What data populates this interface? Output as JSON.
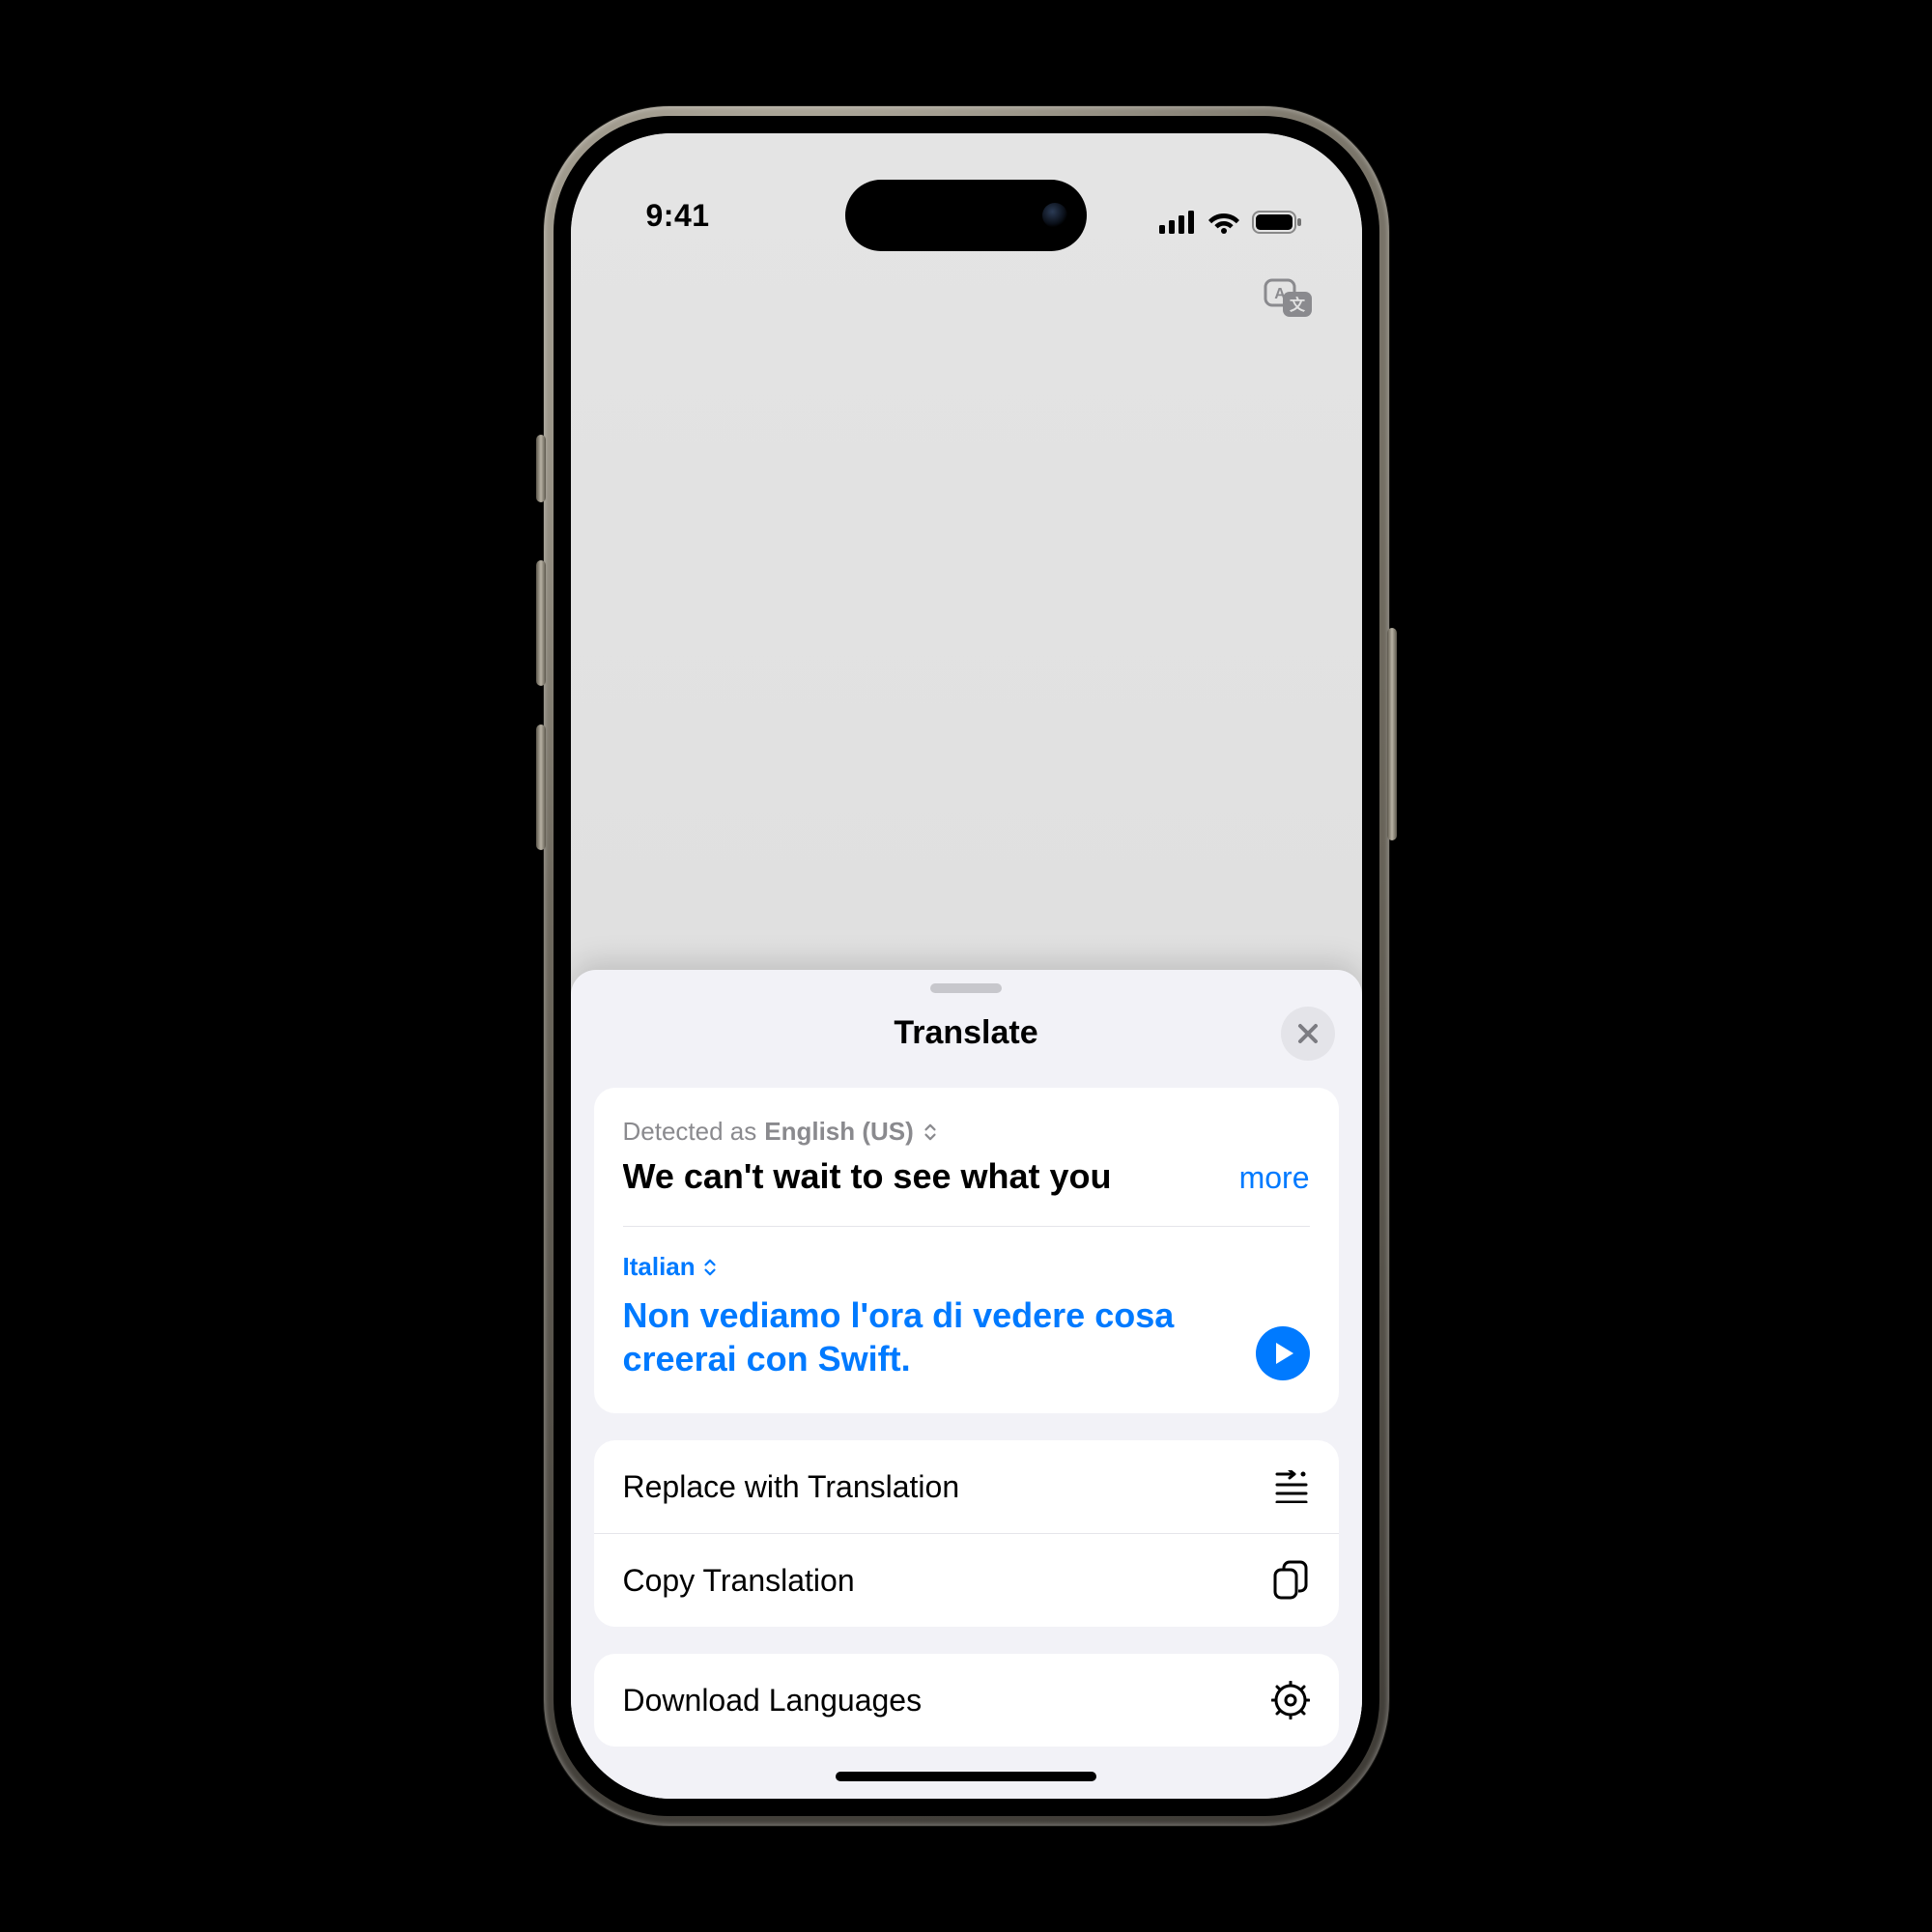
{
  "statusbar": {
    "time": "9:41"
  },
  "sheet": {
    "title": "Translate",
    "source": {
      "detected_prefix": "Detected as ",
      "detected_lang": "English (US)",
      "text": "We can't wait to see what you",
      "more_label": "more"
    },
    "target": {
      "lang": "Italian",
      "text": "Non vediamo l'ora di vedere cosa creerai con Swift."
    },
    "actions": {
      "replace": "Replace with Translation",
      "copy": "Copy Translation",
      "download": "Download Languages"
    }
  }
}
